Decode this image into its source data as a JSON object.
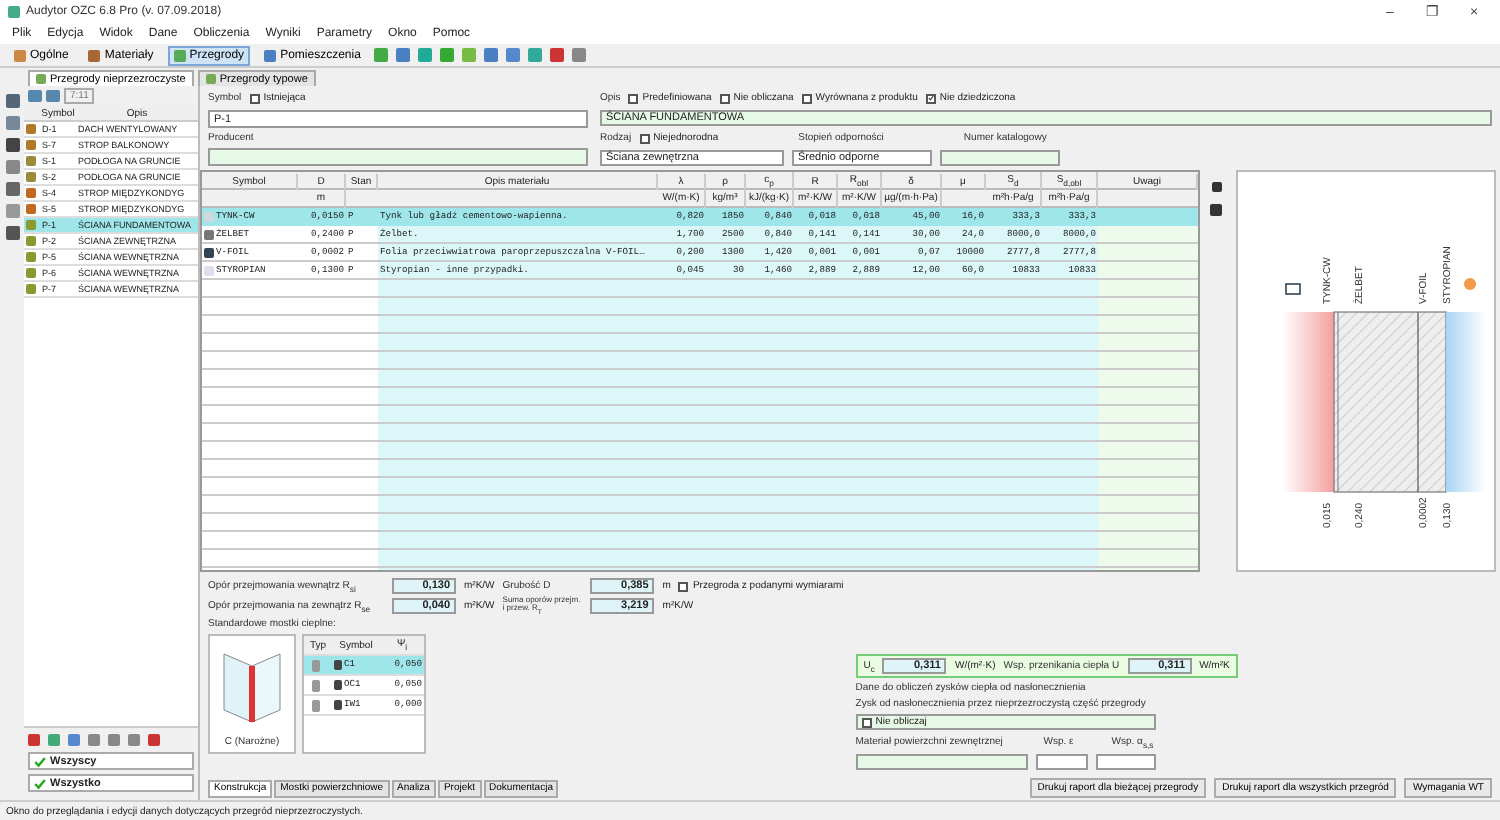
{
  "window": {
    "title": "Audytor OZC 6.8 Pro (v. 07.09.2018)",
    "controls": [
      "–",
      "❐",
      "×"
    ]
  },
  "menu": [
    "Plik",
    "Edycja",
    "Widok",
    "Dane",
    "Obliczenia",
    "Wyniki",
    "Parametry",
    "Okno",
    "Pomoc"
  ],
  "toolbar": [
    {
      "label": "Ogólne",
      "selected": false
    },
    {
      "label": "Materiały",
      "selected": false
    },
    {
      "label": "Przegrody",
      "selected": true
    },
    {
      "label": "Pomieszczenia",
      "selected": false
    }
  ],
  "subtabs": [
    {
      "label": "Przegrody nieprzezroczyste",
      "selected": true
    },
    {
      "label": "Przegrody typowe",
      "selected": false
    }
  ],
  "list": {
    "counter": "7:11",
    "columns": [
      "Symbol",
      "Opis"
    ],
    "rows": [
      {
        "symbol": "D-1",
        "description": "DACH WENTYLOWANY",
        "kind": "roof",
        "selected": false
      },
      {
        "symbol": "S-7",
        "description": "STROP BALKONOWY",
        "kind": "roof",
        "selected": false
      },
      {
        "symbol": "S-1",
        "description": "PODŁOGA NA GRUNCIE",
        "kind": "floor",
        "selected": false
      },
      {
        "symbol": "S-2",
        "description": "PODŁOGA NA GRUNCIE",
        "kind": "floor",
        "selected": false
      },
      {
        "symbol": "S-4",
        "description": "STROP MIĘDZYKONDYG",
        "kind": "ceiling",
        "selected": false
      },
      {
        "symbol": "S-5",
        "description": "STROP MIĘDZYKONDYG",
        "kind": "ceiling",
        "selected": false
      },
      {
        "symbol": "P-1",
        "description": "ŚCIANA FUNDAMENTOWA",
        "kind": "wall",
        "selected": true
      },
      {
        "symbol": "P-2",
        "description": "ŚCIANA ZEWNĘTRZNA",
        "kind": "wall",
        "selected": false
      },
      {
        "symbol": "P-5",
        "description": "ŚCIANA WEWNĘTRZNA",
        "kind": "wall",
        "selected": false
      },
      {
        "symbol": "P-6",
        "description": "ŚCIANA WEWNĘTRZNA",
        "kind": "wall",
        "selected": false
      },
      {
        "symbol": "P-7",
        "description": "ŚCIANA WEWNĘTRZNA",
        "kind": "wall",
        "selected": false
      }
    ]
  },
  "filters": [
    "Wszyscy",
    "Wszystko"
  ],
  "form": {
    "symbol_label": "Symbol",
    "existing": {
      "label": "Istniejąca",
      "checked": false
    },
    "symbol": "P-1",
    "description_label": "Opis",
    "flags": [
      {
        "label": "Predefiniowana",
        "checked": false
      },
      {
        "label": "Nie obliczana",
        "checked": false
      },
      {
        "label": "Wyrównana z produktu",
        "checked": false
      },
      {
        "label": "Nie dziedziczona",
        "checked": true
      }
    ],
    "description": "ŚCIANA FUNDAMENTOWA",
    "producer_label": "Producent",
    "type_label": "Rodzaj",
    "inhomogeneous": {
      "label": "Niejednorodna",
      "checked": false
    },
    "type": "Ściana zewnętrzna",
    "resistance_label": "Stopień odporności",
    "resistance": "Średnio odporne",
    "catalog_label": "Numer katalogowy"
  },
  "layers": {
    "columns": [
      {
        "label": "Symbol"
      },
      {
        "label": "D",
        "unit": "m"
      },
      {
        "label": "Stan"
      },
      {
        "label": "Opis materiału"
      },
      {
        "label": "λ",
        "unit": "W/(m·K)"
      },
      {
        "label": "ρ",
        "unit": "kg/m³"
      },
      {
        "label": "c$_{p}$",
        "unit": "kJ/(kg·K)"
      },
      {
        "label": "R",
        "unit": "m²·K/W"
      },
      {
        "label": "R$_{obl}$",
        "unit": "m²·K/W"
      },
      {
        "label": "δ",
        "unit": "µg/(m·h·Pa)"
      },
      {
        "label": "μ"
      },
      {
        "label": "S$_{d}$",
        "unit": "m²h·Pa/g"
      },
      {
        "label": "S$_{d,obl}$",
        "unit": "m²h·Pa/g"
      },
      {
        "label": "Uwagi"
      }
    ],
    "rows": [
      {
        "kind": "plaster",
        "selected": true,
        "cells": [
          "TYNK-CW",
          "0,0150",
          "P",
          "Tynk lub gładź cementowo-wapienna.",
          "0,820",
          "1850",
          "0,840",
          "0,018",
          "0,018",
          "45,00",
          "16,0",
          "333,3",
          "333,3"
        ]
      },
      {
        "kind": "concrete",
        "selected": false,
        "cells": [
          "ŻELBET",
          "0,2400",
          "P",
          "Żelbet.",
          "1,700",
          "2500",
          "0,840",
          "0,141",
          "0,141",
          "30,00",
          "24,0",
          "8000,0",
          "8000,0"
        ]
      },
      {
        "kind": "foil",
        "selected": false,
        "cells": [
          "V-FOIL",
          "0,0002",
          "P",
          "Folia przeciwwiatrowa paroprzepuszczalna V-FOIL…",
          "0,200",
          "1300",
          "1,420",
          "0,001",
          "0,001",
          "0,07",
          "10000",
          "2777,8",
          "2777,8"
        ]
      },
      {
        "kind": "insulation",
        "selected": false,
        "cells": [
          "STYROPIAN",
          "0,1300",
          "P",
          "Styropian - inne przypadki.",
          "0,045",
          "30",
          "1,460",
          "2,889",
          "2,889",
          "12,00",
          "60,0",
          "10833",
          "10833"
        ]
      }
    ]
  },
  "section": {
    "layer_labels": [
      "TYNK-CW",
      "ŻELBET",
      "V-FOIL",
      "STYROPIAN"
    ],
    "thickness_labels": [
      "0,015",
      "0,240",
      "0,0002",
      "0,130"
    ]
  },
  "thermal": {
    "rsi_label": "Opór przejmowania wewnątrz R$_{si}$",
    "rsi": "0,130",
    "rse_label": "Opór przejmowania na zewnątrz R$_{se}$",
    "rse": "0,040",
    "rsi_unit": "m²K/W",
    "rse_unit": "m²K/W",
    "rt_unit": "m²K/W",
    "thickness_label": "Grubość D",
    "thickness": "0,385",
    "thickness_unit": "m",
    "rt_label": "Suma oporów przejm. i przew. R$_{T}$",
    "rt": "3,219",
    "dimensions": {
      "label": "Przegroda z podanymi wymiarami",
      "checked": false
    }
  },
  "bridges": {
    "title": "Standardowe mostki cieplne:",
    "caption": "C (Narożne)",
    "columns": [
      "Typ",
      "Symbol",
      "Ψ$_{i}$"
    ],
    "rows": [
      {
        "symbol": "C1",
        "value": "0,050",
        "selected": true
      },
      {
        "symbol": "OC1",
        "value": "0,050",
        "selected": false
      },
      {
        "symbol": "IW1",
        "value": "0,000",
        "selected": false
      }
    ]
  },
  "u_value": {
    "uc_label": "U$_{c}$",
    "uc": "0,311",
    "uc_unit": "W/(m²·K)",
    "u_label": "Wsp. przenikania ciepła U",
    "u": "0,311",
    "u_unit": "W/m²K"
  },
  "solar": {
    "title": "Dane do obliczeń zysków ciepła od nasłonecznienia",
    "gain_label": "Zysk od nasłonecznienia przez nieprzezroczystą część przegrody",
    "gain": {
      "label": "Nie obliczaj",
      "checked": false
    },
    "material_label": "Materiał powierzchni zewnętrznej",
    "eps_label": "Wsp. ε",
    "alpha_label": "Wsp. α$_{s,s}$"
  },
  "tabs": [
    {
      "label": "Konstrukcja",
      "selected": true
    },
    {
      "label": "Mostki powierzchniowe",
      "selected": false
    },
    {
      "label": "Analiza",
      "selected": false
    },
    {
      "label": "Projekt",
      "selected": false
    },
    {
      "label": "Dokumentacja",
      "selected": false
    }
  ],
  "actions": [
    "Drukuj raport dla bieżącej przegrody",
    "Drukuj raport dla wszystkich przegród",
    "Wymagania WT"
  ],
  "status_bar": "Okno do przeglądania i edycji danych dotyczących przegród nieprzezroczystych."
}
